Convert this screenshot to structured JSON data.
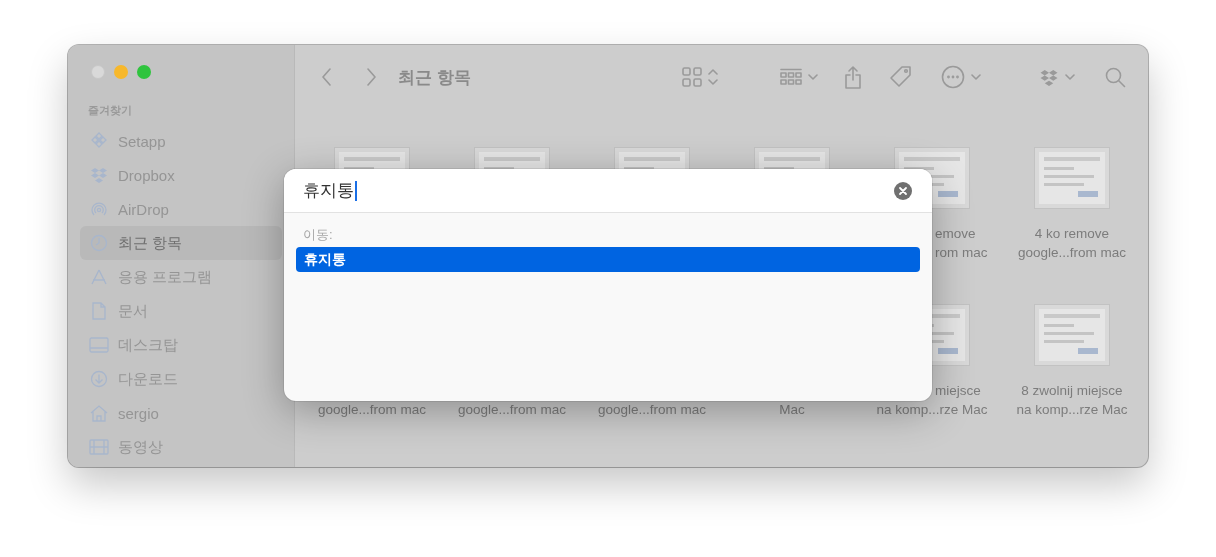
{
  "sidebar": {
    "header": "즐겨찾기",
    "items": [
      {
        "label": "Setapp",
        "selected": false
      },
      {
        "label": "Dropbox",
        "selected": false
      },
      {
        "label": "AirDrop",
        "selected": false
      },
      {
        "label": "최근 항목",
        "selected": true
      },
      {
        "label": "응용 프로그램",
        "selected": false
      },
      {
        "label": "문서",
        "selected": false
      },
      {
        "label": "데스크탑",
        "selected": false
      },
      {
        "label": "다운로드",
        "selected": false
      },
      {
        "label": "sergio",
        "selected": false
      },
      {
        "label": "동영상",
        "selected": false
      }
    ]
  },
  "toolbar": {
    "title": "최근 항목"
  },
  "files": [
    {
      "kind": "document"
    },
    {
      "kind": "document"
    },
    {
      "kind": "document"
    },
    {
      "kind": "document"
    },
    {
      "kind": "document",
      "lines": [
        "emove",
        "rom mac"
      ]
    },
    {
      "kind": "document",
      "lines": [
        "4 ko remove",
        "google...from mac"
      ]
    },
    {
      "lines": [
        "google...from mac"
      ]
    },
    {
      "lines": [
        "google...from mac"
      ]
    },
    {
      "lines": [
        "google...from mac"
      ]
    },
    {
      "lines": [
        "Mac"
      ]
    },
    {
      "kind": "document",
      "lines": [
        "miejsce",
        "na komp...rze Mac"
      ]
    },
    {
      "kind": "document",
      "lines": [
        "8 zwolnij miejsce",
        "na komp...rze Mac"
      ]
    }
  ],
  "dialog": {
    "query": "휴지통",
    "section_label": "이동:",
    "results": [
      {
        "label": "휴지통",
        "selected": true
      }
    ]
  }
}
